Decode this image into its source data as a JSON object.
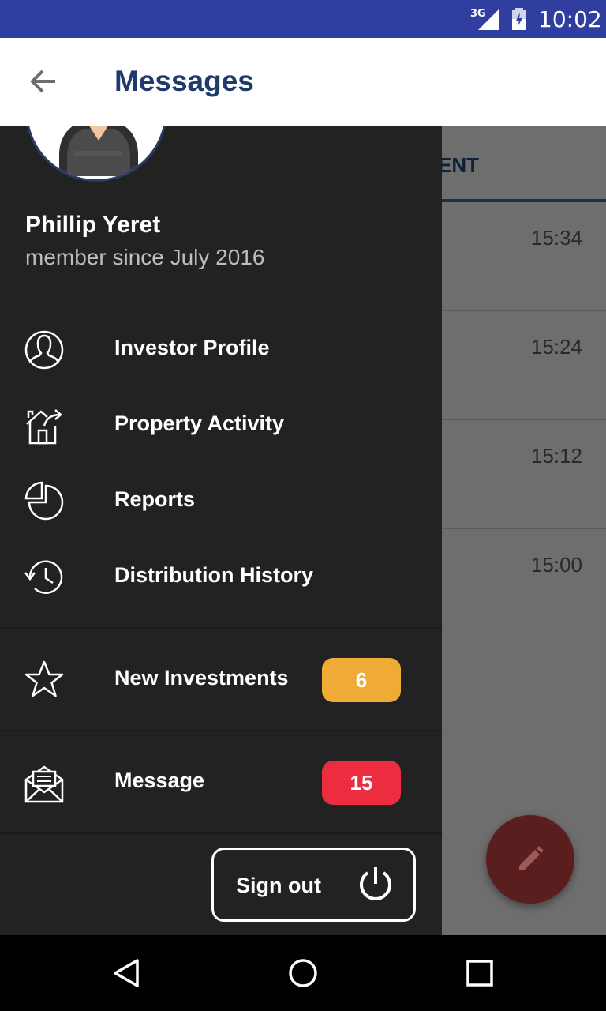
{
  "status_bar": {
    "network": "3G",
    "time": "10:02"
  },
  "app_bar": {
    "title": "Messages"
  },
  "background": {
    "tab_partial": "ENT",
    "rows": [
      {
        "time": "15:34"
      },
      {
        "time": "15:24"
      },
      {
        "time": "15:12"
      },
      {
        "time": "15:00"
      }
    ]
  },
  "drawer": {
    "user": {
      "name": "Phillip Yeret",
      "since": "member since July 2016"
    },
    "items": [
      {
        "label": "Investor Profile",
        "icon": "user-icon"
      },
      {
        "label": "Property Activity",
        "icon": "house-arrow-icon"
      },
      {
        "label": "Reports",
        "icon": "pie-chart-icon"
      },
      {
        "label": "Distribution History",
        "icon": "history-icon"
      },
      {
        "label": "New Investments",
        "icon": "star-icon",
        "badge": "6",
        "badge_color": "#f0ab36"
      },
      {
        "label": "Message",
        "icon": "envelope-icon",
        "badge": "15",
        "badge_color": "#ec2d3f"
      }
    ],
    "signout": {
      "label": "Sign out"
    }
  },
  "colors": {
    "status_bar": "#303f9f",
    "title": "#1f3b6b",
    "drawer_bg": "#222222",
    "fab": "#5a1e1e"
  }
}
